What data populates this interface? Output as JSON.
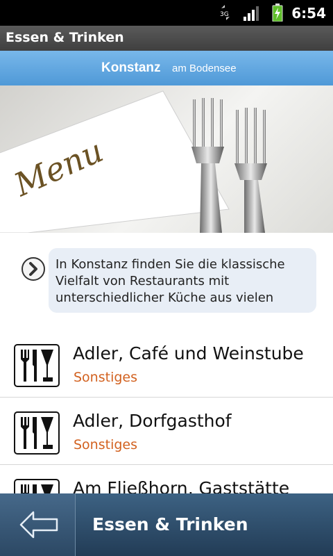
{
  "status_bar": {
    "network": "3G",
    "time": "6:54"
  },
  "title_bar": {
    "title": "Essen & Trinken"
  },
  "banner": {
    "brand": "Konstanz",
    "suffix": "am Bodensee"
  },
  "hero": {
    "menu_text": "Menu"
  },
  "intro": {
    "text": "In Konstanz finden Sie die klassische Vielfalt von Restaurants mit unterschiedlicher Küche aus vielen"
  },
  "list": {
    "items": [
      {
        "name": "Adler, Café und Weinstube",
        "category": "Sonstiges"
      },
      {
        "name": "Adler, Dorfgasthof",
        "category": "Sonstiges"
      },
      {
        "name": "Am Fließhorn, Gaststätte",
        "category": ""
      }
    ]
  },
  "bottom_bar": {
    "title": "Essen & Trinken"
  },
  "colors": {
    "accent_orange": "#d2611f",
    "banner_blue": "#5aa3de",
    "bottom_bar": "#2e4d6c"
  }
}
